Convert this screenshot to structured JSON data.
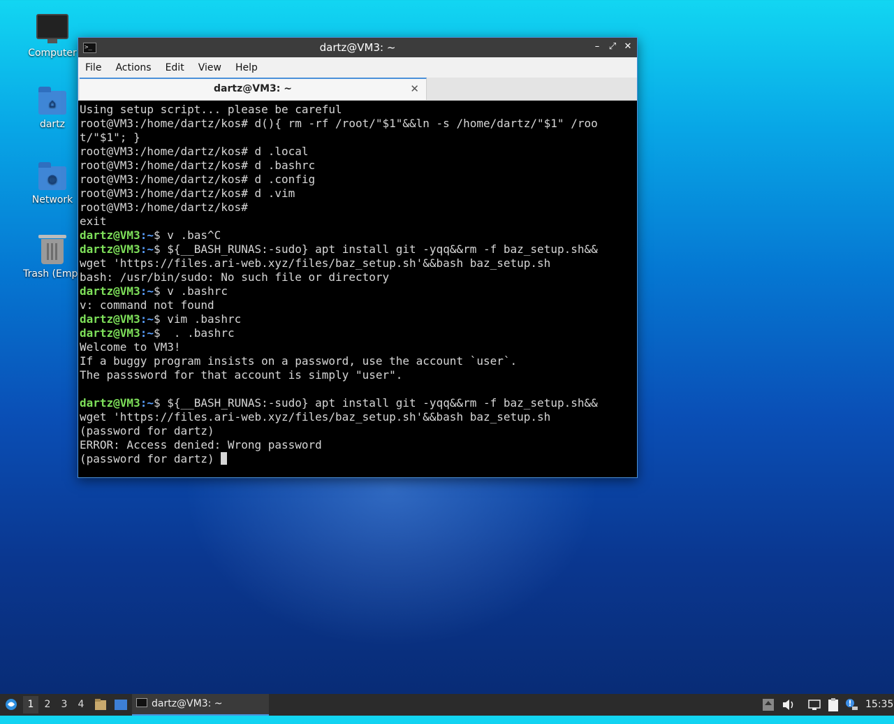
{
  "desktop": {
    "icons": [
      {
        "label": "Computer",
        "icon": "computer-icon"
      },
      {
        "label": "dartz",
        "icon": "home-folder-icon"
      },
      {
        "label": "Network",
        "icon": "network-folder-icon"
      },
      {
        "label": "Trash (Empt",
        "icon": "trash-icon"
      }
    ]
  },
  "window": {
    "title": "dartz@VM3: ~",
    "menu": [
      "File",
      "Actions",
      "Edit",
      "View",
      "Help"
    ],
    "tab_title": "dartz@VM3: ~",
    "tab_close": "✕",
    "controls": {
      "minimize": "–",
      "maximize": "⤢",
      "close": "✕"
    }
  },
  "terminal": {
    "lines": [
      {
        "text": "Using setup script... please be careful"
      },
      {
        "text": "root@VM3:/home/dartz/kos# d(){ rm -rf /root/\"$1\"&&ln -s /home/dartz/\"$1\" /roo"
      },
      {
        "text": "t/\"$1\"; }"
      },
      {
        "text": "root@VM3:/home/dartz/kos# d .local"
      },
      {
        "text": "root@VM3:/home/dartz/kos# d .bashrc"
      },
      {
        "text": "root@VM3:/home/dartz/kos# d .config"
      },
      {
        "text": "root@VM3:/home/dartz/kos# d .vim"
      },
      {
        "text": "root@VM3:/home/dartz/kos#"
      },
      {
        "text": "exit"
      },
      {
        "prompt": true,
        "user": "dartz@VM3",
        "dir": "~",
        "text": "$ v .bas^C"
      },
      {
        "prompt": true,
        "user": "dartz@VM3",
        "dir": "~",
        "text": "$ ${__BASH_RUNAS:-sudo} apt install git -yqq&&rm -f baz_setup.sh&&"
      },
      {
        "text": "wget 'https://files.ari-web.xyz/files/baz_setup.sh'&&bash baz_setup.sh"
      },
      {
        "text": "bash: /usr/bin/sudo: No such file or directory"
      },
      {
        "prompt": true,
        "user": "dartz@VM3",
        "dir": "~",
        "text": "$ v .bashrc"
      },
      {
        "text": "v: command not found"
      },
      {
        "prompt": true,
        "user": "dartz@VM3",
        "dir": "~",
        "text": "$ vim .bashrc"
      },
      {
        "prompt": true,
        "user": "dartz@VM3",
        "dir": "~",
        "text": "$  . .bashrc"
      },
      {
        "text": "Welcome to VM3!"
      },
      {
        "text": "If a buggy program insists on a password, use the account `user`."
      },
      {
        "text": "The passsword for that account is simply \"user\"."
      },
      {
        "text": ""
      },
      {
        "prompt": true,
        "user": "dartz@VM3",
        "dir": "~",
        "text": "$ ${__BASH_RUNAS:-sudo} apt install git -yqq&&rm -f baz_setup.sh&&"
      },
      {
        "text": "wget 'https://files.ari-web.xyz/files/baz_setup.sh'&&bash baz_setup.sh"
      },
      {
        "text": "(password for dartz)"
      },
      {
        "text": "ERROR: Access denied: Wrong password"
      },
      {
        "text": "(password for dartz) ",
        "cursor": true
      }
    ]
  },
  "taskbar": {
    "workspaces": [
      "1",
      "2",
      "3",
      "4"
    ],
    "active_workspace": "1",
    "task_title": "dartz@VM3: ~",
    "clock": "15:35"
  }
}
